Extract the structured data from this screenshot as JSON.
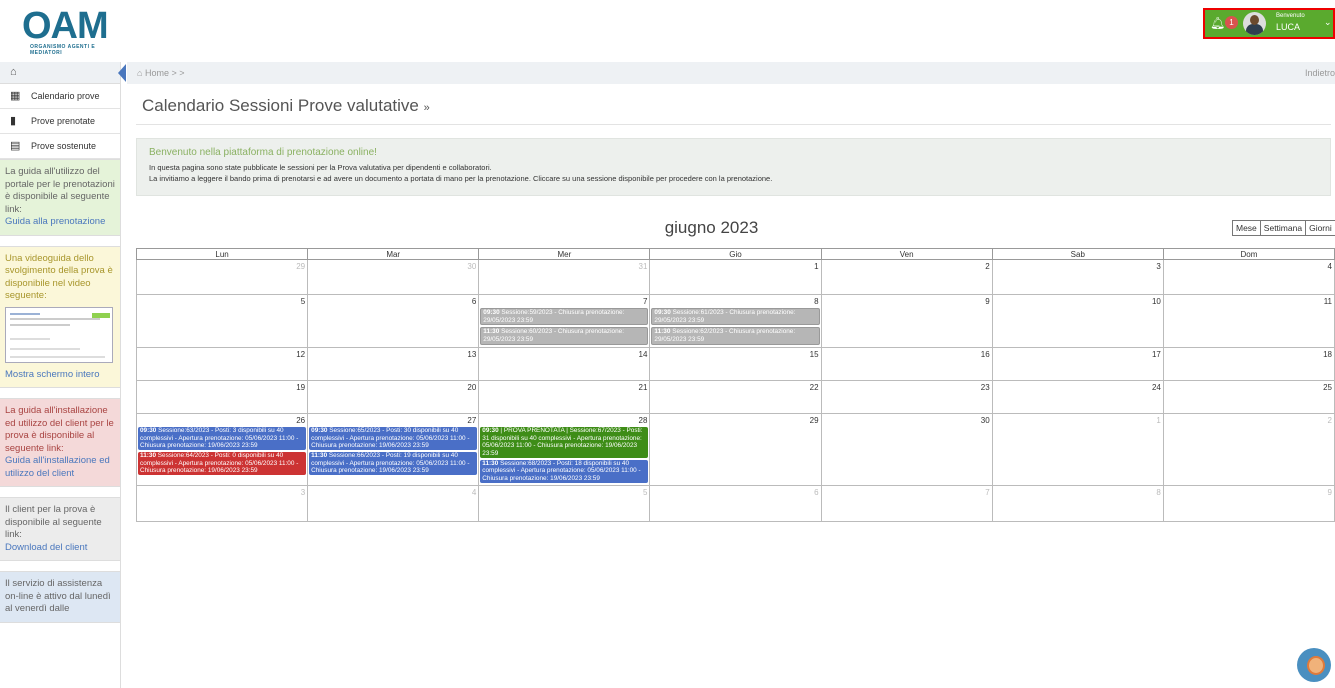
{
  "header": {
    "logo_text": "OAM",
    "logo_subtitle": "ORGANISMO AGENTI E MEDIATORI",
    "notification_count": "1",
    "welcome_label": "Benvenuto",
    "user_name": "LUCA"
  },
  "sidebar": {
    "items": [
      {
        "label": "Calendario prove",
        "icon": "calendar-icon"
      },
      {
        "label": "Prove prenotate",
        "icon": "file-icon"
      },
      {
        "label": "Prove sostenute",
        "icon": "list-icon"
      }
    ],
    "guide": {
      "text": "La guida all'utilizzo del portale per le prenotazioni è disponibile al seguente link:",
      "link": "Guida alla prenotazione"
    },
    "video": {
      "text": "Una videoguida dello svolgimento della prova è disponibile nel video seguente:",
      "link": "Mostra schermo intero"
    },
    "install": {
      "text": "La guida all'installazione ed utilizzo del client per le prova è disponibile al seguente link:",
      "link": "Guida all'installazione ed utilizzo del client"
    },
    "client": {
      "text": "Il client per la prova è disponibile al seguente link:",
      "link": "Download del client"
    },
    "assist": {
      "text": "Il servizio di assistenza on-line è attivo dal lunedì al venerdì dalle"
    }
  },
  "breadcrumb": {
    "home": "Home",
    "separator": ">",
    "back": "Indietro"
  },
  "page": {
    "title": "Calendario Sessioni Prove valutative",
    "title_suffix": "»",
    "welcome_title": "Benvenuto nella piattaforma di prenotazione online!",
    "welcome_line1": "In questa pagina sono state pubblicate le sessioni per la Prova valutativa per dipendenti e collaboratori.",
    "welcome_line2": "La invitiamo a leggere il bando prima di prenotarsi e ad avere un documento a portata di mano per la prenotazione. Cliccare su una sessione disponibile per procedere con la prenotazione."
  },
  "calendar": {
    "month_title": "giugno 2023",
    "views": [
      "Mese",
      "Settimana",
      "Giorni"
    ],
    "weekdays": [
      "Lun",
      "Mar",
      "Mer",
      "Gio",
      "Ven",
      "Sab",
      "Dom"
    ],
    "weeks": [
      [
        {
          "day": "29",
          "other": true
        },
        {
          "day": "30",
          "other": true
        },
        {
          "day": "31",
          "other": true
        },
        {
          "day": "1"
        },
        {
          "day": "2"
        },
        {
          "day": "3"
        },
        {
          "day": "4"
        }
      ],
      [
        {
          "day": "5"
        },
        {
          "day": "6"
        },
        {
          "day": "7",
          "events": [
            {
              "time": "09:30",
              "text": "Sessione:59/2023 - Chiusura prenotazione: 29/05/2023 23:59",
              "color": "gray"
            },
            {
              "time": "11:30",
              "text": "Sessione:60/2023 - Chiusura prenotazione: 29/05/2023 23:59",
              "color": "gray"
            }
          ]
        },
        {
          "day": "8",
          "events": [
            {
              "time": "09:30",
              "text": "Sessione:61/2023 - Chiusura prenotazione: 29/05/2023 23:59",
              "color": "gray"
            },
            {
              "time": "11:30",
              "text": "Sessione:62/2023 - Chiusura prenotazione: 29/05/2023 23:59",
              "color": "gray"
            }
          ]
        },
        {
          "day": "9"
        },
        {
          "day": "10"
        },
        {
          "day": "11"
        }
      ],
      [
        {
          "day": "12"
        },
        {
          "day": "13"
        },
        {
          "day": "14"
        },
        {
          "day": "15"
        },
        {
          "day": "16"
        },
        {
          "day": "17"
        },
        {
          "day": "18"
        }
      ],
      [
        {
          "day": "19"
        },
        {
          "day": "20"
        },
        {
          "day": "21"
        },
        {
          "day": "22"
        },
        {
          "day": "23"
        },
        {
          "day": "24"
        },
        {
          "day": "25"
        }
      ],
      [
        {
          "day": "26",
          "events": [
            {
              "time": "09:30",
              "text": "Sessione:63/2023 - Posti: 3 disponibili su 40 complessivi - Apertura prenotazione: 05/06/2023 11:00 - Chiusura prenotazione: 19/06/2023 23:59",
              "color": "blue"
            },
            {
              "time": "11:30",
              "text": "Sessione:64/2023 - Posti: 0 disponibili su 40 complessivi - Apertura prenotazione: 05/06/2023 11:00 - Chiusura prenotazione: 19/06/2023 23:59",
              "color": "red"
            }
          ]
        },
        {
          "day": "27",
          "events": [
            {
              "time": "09:30",
              "text": "Sessione:65/2023 - Posti: 30 disponibili su 40 complessivi - Apertura prenotazione: 05/06/2023 11:00 - Chiusura prenotazione: 19/06/2023 23:59",
              "color": "blue"
            },
            {
              "time": "11:30",
              "text": "Sessione:66/2023 - Posti: 19 disponibili su 40 complessivi - Apertura prenotazione: 05/06/2023 11:00 - Chiusura prenotazione: 19/06/2023 23:59",
              "color": "blue"
            }
          ]
        },
        {
          "day": "28",
          "events": [
            {
              "time": "09:30",
              "text": "| PROVA PRENOTATA | Sessione:67/2023 - Posti: 31 disponibili su 40 complessivi - Apertura prenotazione: 05/06/2023 11:00 - Chiusura prenotazione: 19/06/2023 23:59",
              "color": "green"
            },
            {
              "time": "11:30",
              "text": "Sessione:68/2023 - Posti: 18 disponibili su 40 complessivi - Apertura prenotazione: 05/06/2023 11:00 - Chiusura prenotazione: 19/06/2023 23:59",
              "color": "blue"
            }
          ]
        },
        {
          "day": "29"
        },
        {
          "day": "30"
        },
        {
          "day": "1",
          "other": true
        },
        {
          "day": "2",
          "other": true
        }
      ],
      [
        {
          "day": "3",
          "other": true
        },
        {
          "day": "4",
          "other": true
        },
        {
          "day": "5",
          "other": true
        },
        {
          "day": "6",
          "other": true
        },
        {
          "day": "7",
          "other": true
        },
        {
          "day": "8",
          "other": true
        },
        {
          "day": "9",
          "other": true
        }
      ]
    ]
  },
  "colors": {
    "brand": "#1e6e8f",
    "user_bar": "#5aaa2e",
    "event_blue": "#4a6fc7",
    "event_red": "#cc3333",
    "event_green": "#3e8d17",
    "event_gray": "#b6b6b6"
  }
}
